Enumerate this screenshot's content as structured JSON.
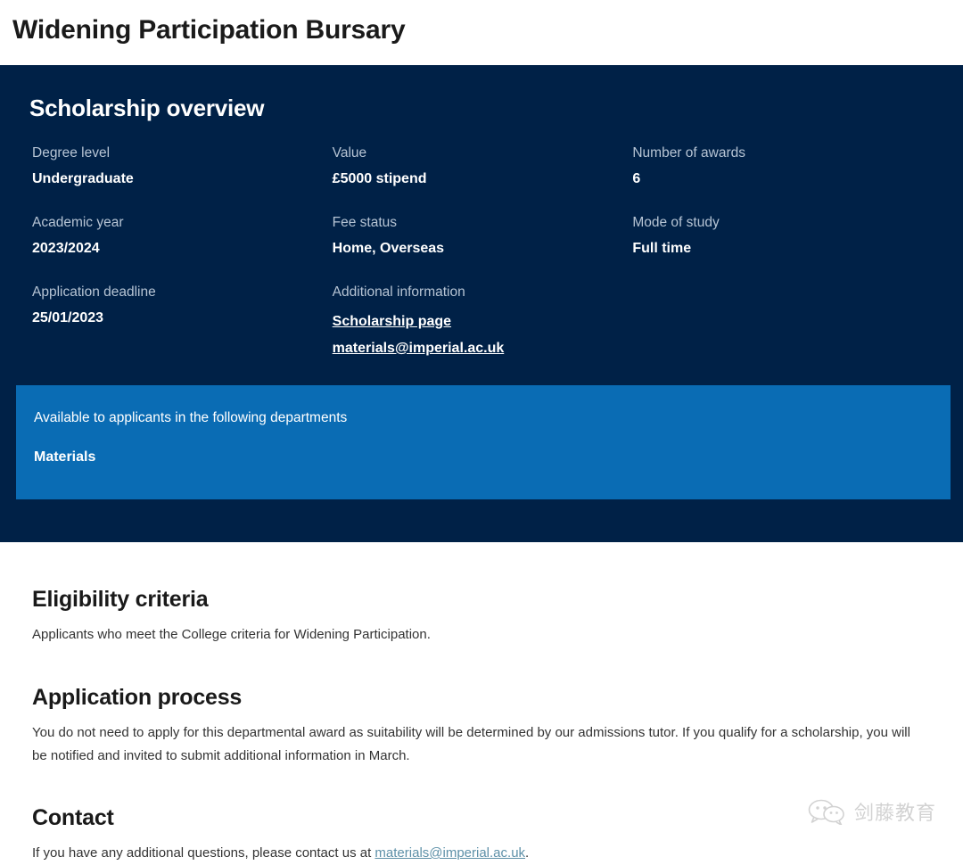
{
  "page": {
    "title": "Widening Participation Bursary"
  },
  "overview": {
    "heading": "Scholarship overview",
    "facts": [
      {
        "label": "Degree level",
        "value": "Undergraduate"
      },
      {
        "label": "Value",
        "value": "£5000 stipend"
      },
      {
        "label": "Number of awards",
        "value": "6"
      },
      {
        "label": "Academic year",
        "value": "2023/2024"
      },
      {
        "label": "Fee status",
        "value": "Home, Overseas"
      },
      {
        "label": "Mode of study",
        "value": "Full time"
      },
      {
        "label": "Application deadline",
        "value": "25/01/2023"
      }
    ],
    "additional_information": {
      "label": "Additional information",
      "links": [
        {
          "text": "Scholarship page"
        },
        {
          "text": "materials@imperial.ac.uk"
        }
      ]
    },
    "departments": {
      "intro": "Available to applicants in the following departments",
      "items": [
        "Materials"
      ]
    }
  },
  "sections": [
    {
      "heading": "Eligibility criteria",
      "body": "Applicants who meet the College criteria for Widening Participation."
    },
    {
      "heading": "Application process",
      "body": "You do not need to apply for this departmental award as suitability will be determined by our admissions tutor. If you qualify for a scholarship, you will be notified and invited to submit additional information in March."
    }
  ],
  "contact": {
    "heading": "Contact",
    "text_before": "If you have any additional questions, please contact us at ",
    "email": "materials@imperial.ac.uk",
    "text_after": "."
  },
  "watermark": {
    "text": "剑藤教育"
  },
  "colors": {
    "navy_panel": "#002147",
    "blue_callout": "#0a6cb4",
    "link_teal": "#5d90a8",
    "label_muted": "#b6c4d4",
    "body_text": "#333333"
  }
}
